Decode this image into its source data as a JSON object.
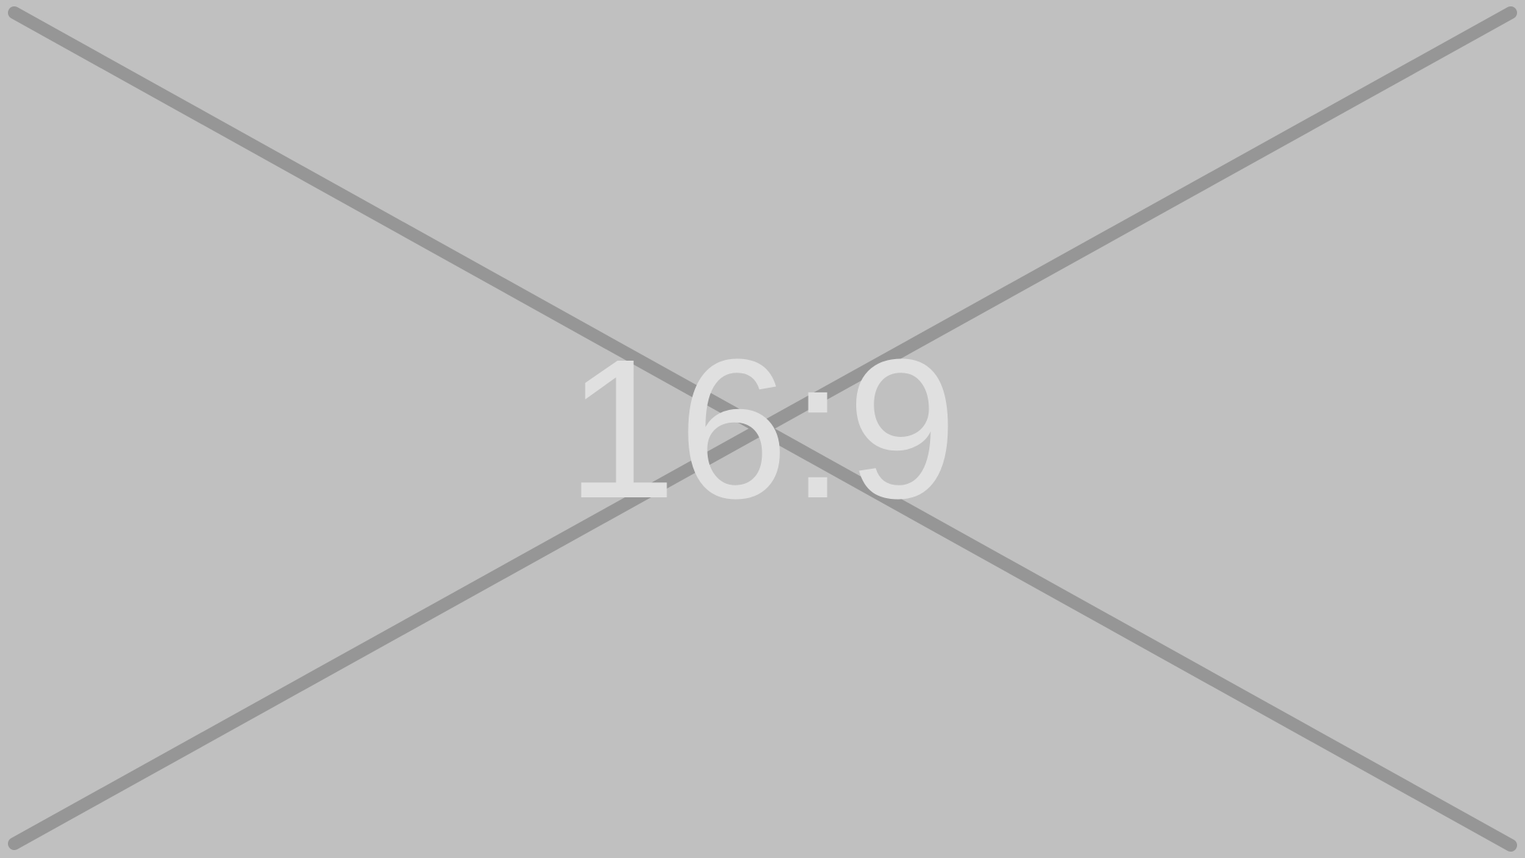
{
  "placeholder": {
    "ratio_label": "16:9",
    "background_color": "#c0c0c0",
    "line_color": "#969696",
    "text_color": "#e0e0e0"
  }
}
